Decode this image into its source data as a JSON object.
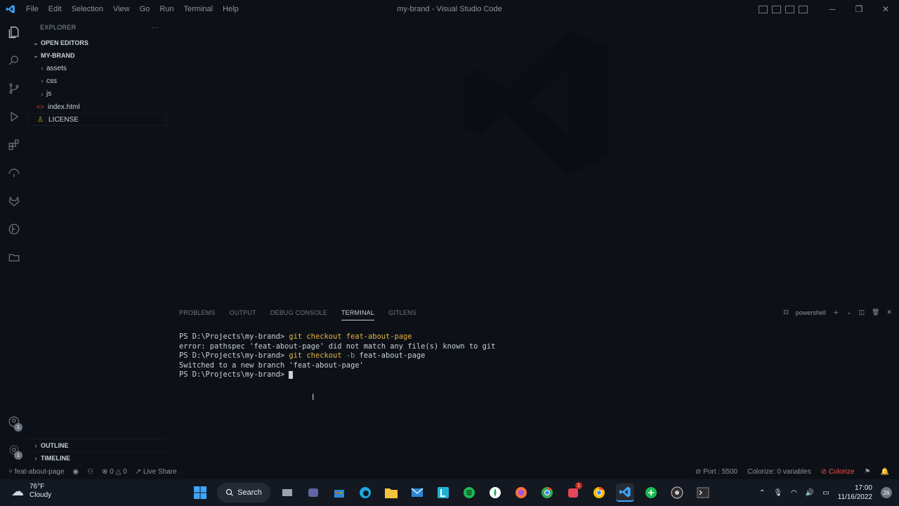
{
  "menu": [
    "File",
    "Edit",
    "Selection",
    "View",
    "Go",
    "Run",
    "Terminal",
    "Help"
  ],
  "window_title": "my-brand - Visual Studio Code",
  "explorer": {
    "title": "EXPLORER",
    "more": "···",
    "open_editors": "OPEN EDITORS",
    "project": "MY-BRAND",
    "items": [
      {
        "label": "assets",
        "type": "folder"
      },
      {
        "label": "css",
        "type": "folder"
      },
      {
        "label": "js",
        "type": "folder"
      },
      {
        "label": "index.html",
        "type": "file"
      },
      {
        "label": "LICENSE",
        "type": "file"
      }
    ],
    "outline": "OUTLINE",
    "timeline": "TIMELINE"
  },
  "panel": {
    "tabs": [
      "PROBLEMS",
      "OUTPUT",
      "DEBUG CONSOLE",
      "TERMINAL",
      "GITLENS"
    ],
    "active_tab": "TERMINAL",
    "shell": "powershell",
    "terminal": {
      "line1_prompt": "PS D:\\Projects\\my-brand> ",
      "line1_cmd": "git checkout feat-about-page",
      "line2": "error: pathspec 'feat-about-page' did not match any file(s) known to git",
      "line3_prompt": "PS D:\\Projects\\my-brand> ",
      "line3_cmd": "git checkout ",
      "line3_flag": "-b",
      "line3_rest": " feat-about-page",
      "line4": "Switched to a new branch 'feat-about-page'",
      "line5_prompt": "PS D:\\Projects\\my-brand> "
    }
  },
  "statusbar": {
    "branch": "feat-about-page",
    "errors": "0",
    "warnings": "0",
    "live_share": "Live Share",
    "port": "Port : 5500",
    "colorize_vars": "Colorize: 0 variables",
    "colorize": "Colorize"
  },
  "accounts_badge": "1",
  "settings_badge": "1",
  "taskbar": {
    "temp": "76°F",
    "condition": "Cloudy",
    "search": "Search",
    "time": "17:00",
    "date": "11/16/2022",
    "notif": "26",
    "app_badge": "1"
  },
  "colors": {
    "accent": "#0078d4",
    "bg": "#0d1117",
    "error": "#f85149"
  }
}
